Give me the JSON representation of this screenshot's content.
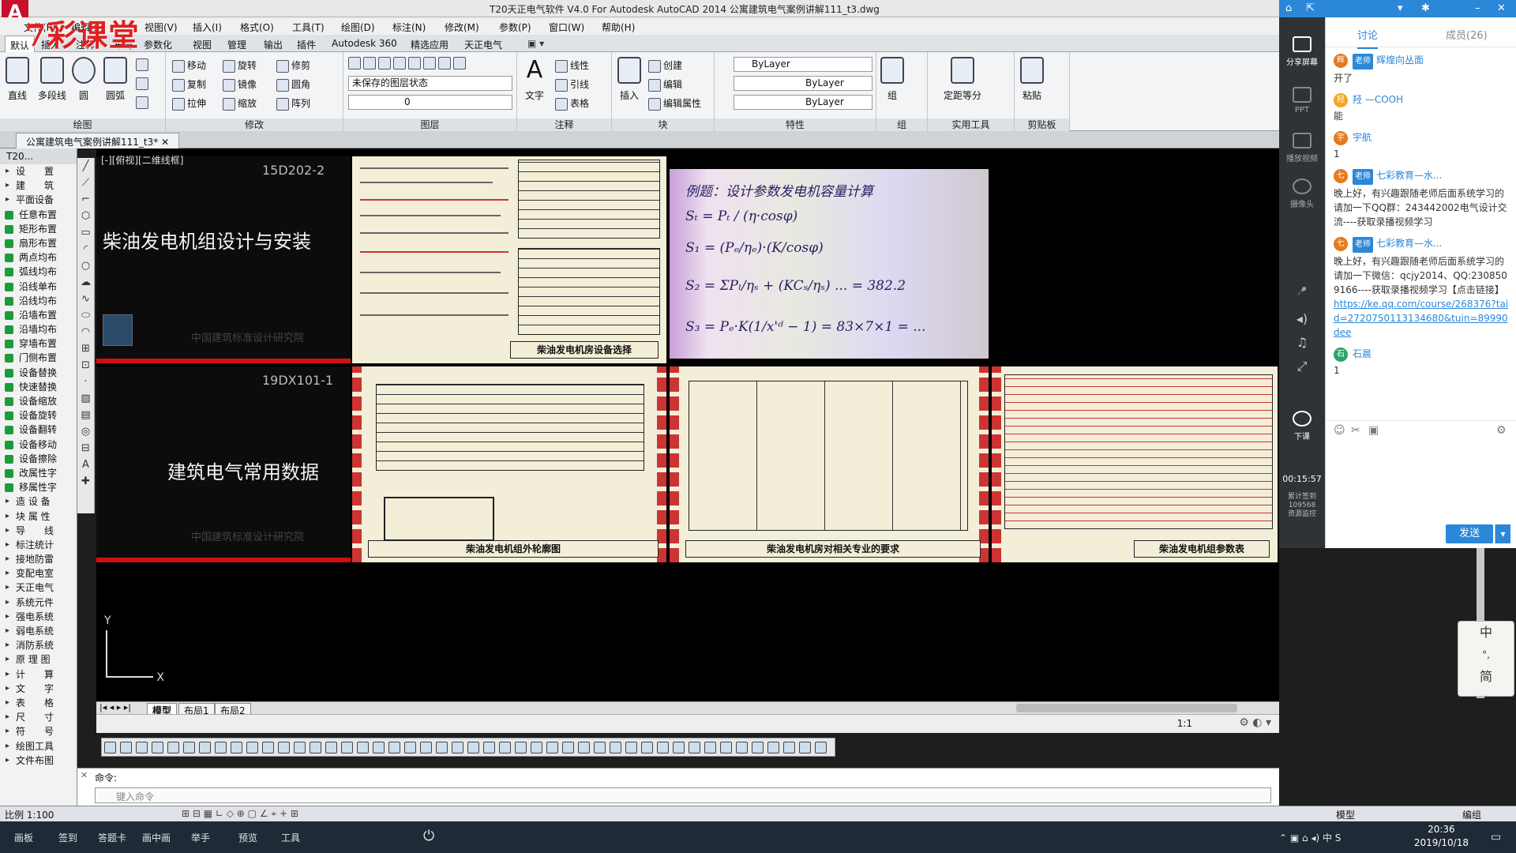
{
  "window": {
    "title": "T20天正电气软件 V4.0 For Autodesk AutoCAD 2014    公寓建筑电气案例讲解111_t3.dwg",
    "app_icon": "A",
    "watermark": "7彩课堂"
  },
  "menus": [
    "文件(F)",
    "编辑(E)",
    "视图(V)",
    "插入(I)",
    "格式(O)",
    "工具(T)",
    "绘图(D)",
    "标注(N)",
    "修改(M)",
    "参数(P)",
    "窗口(W)",
    "帮助(H)"
  ],
  "ribbon_tabs": [
    "默认",
    "插入",
    "注释",
    "布局",
    "参数化",
    "视图",
    "管理",
    "输出",
    "插件",
    "Autodesk 360",
    "精选应用",
    "天正电气"
  ],
  "ribbon": {
    "draw": {
      "label": "绘图",
      "tools": [
        "直线",
        "多段线",
        "圆",
        "圆弧"
      ]
    },
    "modify": {
      "label": "修改",
      "tools": [
        "移动",
        "旋转",
        "修剪",
        "复制",
        "镜像",
        "圆角",
        "拉伸",
        "缩放",
        "阵列"
      ]
    },
    "layer": {
      "label": "图层",
      "state": "未保存的图层状态",
      "current": "0"
    },
    "annotation": {
      "label": "注释",
      "text": "文字",
      "tools": [
        "线性",
        "引线",
        "表格"
      ]
    },
    "block": {
      "label": "块",
      "insert": "插入",
      "tools": [
        "创建",
        "编辑",
        "编辑属性"
      ]
    },
    "properties": {
      "label": "特性",
      "color": "ByLayer",
      "linetype": "ByLayer",
      "lineweight": "ByLayer"
    },
    "group": {
      "label": "组",
      "tool": "组"
    },
    "utilities": {
      "label": "实用工具",
      "tool": "定距等分"
    },
    "clipboard": {
      "label": "剪贴板",
      "tool": "粘贴"
    }
  },
  "document_tab": "公寓建筑电气案例讲解111_t3*",
  "left_panel": {
    "header": "T20...",
    "items": [
      "设　　置",
      "建　　筑",
      "平面设备",
      "任意布置",
      "矩形布置",
      "扇形布置",
      "两点均布",
      "弧线均布",
      "沿线单布",
      "沿线均布",
      "沿墙布置",
      "沿墙均布",
      "穿墙布置",
      "门侧布置",
      "设备替换",
      "快速替换",
      "设备缩放",
      "设备旋转",
      "设备翻转",
      "设备移动",
      "设备擦除",
      "改属性字",
      "移属性字",
      "造 设 备",
      "块 属 性",
      "导　　线",
      "标注统计",
      "接地防雷",
      "变配电室",
      "天正电气",
      "系统元件",
      "强电系统",
      "弱电系统",
      "消防系统",
      "原 理 图",
      "计　　算",
      "文　　字",
      "表　　格",
      "尺　　寸",
      "符　　号",
      "绘图工具",
      "文件布图"
    ]
  },
  "canvas": {
    "view_label": "[-][俯视][二维线框]",
    "cover1": {
      "code": "15D202-2",
      "title": "柴油发电机组设计与安装",
      "org": "中国建筑标准设计研究院"
    },
    "cover2": {
      "code": "19DX101-1",
      "title": "建筑电气常用数据",
      "org": "中国建筑标准设计研究院"
    },
    "sheet_titles": [
      "柴油发电机房设备选择",
      "柴油发电机组外轮廓图",
      "柴油发电机房对相关专业的要求",
      "柴油发电机组参数表"
    ],
    "ucs": {
      "x": "X",
      "y": "Y"
    }
  },
  "layout_tabs": [
    "模型",
    "布局1",
    "布局2"
  ],
  "command": {
    "label": "命令:",
    "placeholder": "键入命令"
  },
  "statusbar": {
    "scale": "比例 1:100",
    "model": "模型",
    "annotation_scale": "1:1",
    "mode": "编组"
  },
  "taskbar": {
    "items": [
      "画板",
      "签到",
      "答题卡",
      "画中画",
      "举手",
      "预览",
      "工具"
    ],
    "time": "20:36",
    "date": "2019/10/18"
  },
  "qq": {
    "nav": [
      "分享屏幕",
      "PPT",
      "播放视频",
      "摄像头"
    ],
    "end_class": "下课",
    "timer": "00:15:57",
    "stats": "累计签到\n109568\n资源监控",
    "tabs": [
      "讨论",
      "成员(26)"
    ],
    "messages": [
      {
        "name": "辉煌向丛面",
        "badge": "老师",
        "avatar": "辉",
        "text": "开了"
      },
      {
        "name": "羟 —COOH",
        "badge": "",
        "avatar": "羟",
        "text": "能"
      },
      {
        "name": "宇航",
        "badge": "",
        "avatar": "宇",
        "text": "1"
      },
      {
        "name": "七彩教育—水...",
        "badge": "老师",
        "avatar": "七",
        "text": "晚上好，有兴趣跟随老师后面系统学习的请加一下QQ群：243442002电气设计交流----获取录播视频学习"
      },
      {
        "name": "七彩教育—水...",
        "badge": "老师",
        "avatar": "七",
        "text": "晚上好，有兴趣跟随老师后面系统学习的请加一下微信：qcjy2014、QQ:2308509166----获取录播视频学习【点击链接】",
        "link": "https://ke.qq.com/course/268376?taid=2720750113134680&tuin=89990dee"
      },
      {
        "name": "石晨",
        "badge": "",
        "avatar": "石",
        "text": "1"
      }
    ],
    "send": "发送"
  },
  "ime": [
    "中",
    "简"
  ],
  "colors": {
    "accent": "#2b87d8",
    "cad_bg": "#000000",
    "brand_red": "#c8102e",
    "sheet_paper": "#f3eed8"
  }
}
